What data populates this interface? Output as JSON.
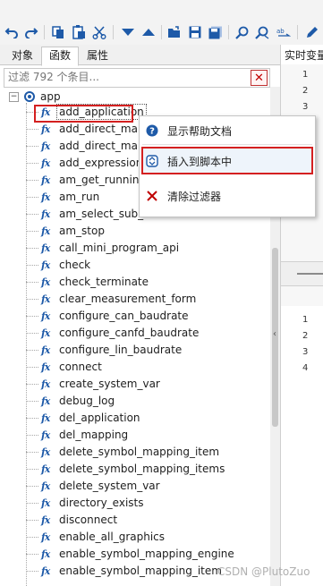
{
  "toolbar": {
    "buttons": [
      "undo-icon",
      "redo-icon",
      "copy-icon",
      "paste-icon",
      "cut-icon",
      "move-down-icon",
      "move-up-icon",
      "open-folder-icon",
      "save-icon",
      "save-all-icon",
      "find-icon",
      "find-replace-icon",
      "replace-text-icon",
      "edit-icon"
    ]
  },
  "tabs": [
    "对象",
    "函数",
    "属性"
  ],
  "active_tab": "函数",
  "filter": {
    "placeholder": "过滤 792 个条目...",
    "clear_glyph": "✕"
  },
  "tree": {
    "root_label": "app",
    "expander": "−",
    "fx_glyph": "fx",
    "items": [
      "add_application",
      "add_direct_map",
      "add_direct_map",
      "add_expression_",
      "am_get_running",
      "am_run",
      "am_select_sub_module",
      "am_stop",
      "call_mini_program_api",
      "check",
      "check_terminate",
      "clear_measurement_form",
      "configure_can_baudrate",
      "configure_canfd_baudrate",
      "configure_lin_baudrate",
      "connect",
      "create_system_var",
      "debug_log",
      "del_application",
      "del_mapping",
      "delete_symbol_mapping_item",
      "delete_symbol_mapping_items",
      "delete_system_var",
      "directory_exists",
      "disconnect",
      "enable_all_graphics",
      "enable_symbol_mapping_engine",
      "enable_symbol_mapping_item"
    ]
  },
  "right_panel": {
    "title": "实时变量",
    "top_line_numbers": [
      "1",
      "2",
      "3"
    ],
    "bottom_line_numbers": [
      "1",
      "2",
      "3",
      "4"
    ],
    "collapse_glyph": "‹"
  },
  "context_menu": {
    "items": [
      {
        "label": "显示帮助文档",
        "icon": "help-icon"
      },
      {
        "label": "插入到脚本中",
        "icon": "insert-icon"
      },
      {
        "label": "清除过滤器",
        "icon": "clear-filter-icon"
      }
    ]
  },
  "watermark": "CSDN @PlutoZuo",
  "colors": {
    "accent": "#1e5aa8",
    "highlight_box": "#d42020",
    "delete": "#c00000"
  }
}
